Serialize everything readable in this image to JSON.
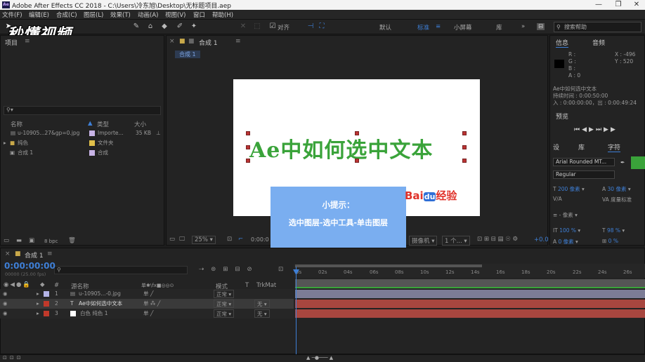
{
  "window": {
    "app_icon": "Ae",
    "title": "Adobe After Effects CC 2018 - C:\\Users\\冷东旭\\Desktop\\无标题项目.aep"
  },
  "menu": [
    "文件(F)",
    "编辑(E)",
    "合成(C)",
    "图层(L)",
    "效果(T)",
    "动画(A)",
    "视图(V)",
    "窗口",
    "帮助(H)"
  ],
  "watermark": "秒懂视频",
  "toolbar": {
    "align_label": "对齐",
    "workspaces": [
      "默认",
      "标准",
      "小屏幕",
      "库"
    ],
    "search_placeholder": "搜索帮助"
  },
  "project": {
    "title": "项目",
    "search_placeholder": "",
    "columns": [
      "名称",
      "类型",
      "大小"
    ],
    "items": [
      {
        "name": "u-10905...27&gp=0.jpg",
        "type": "Importe...",
        "size": "35 KB",
        "color": "#c8b4e6"
      },
      {
        "name": "纯色",
        "type": "文件夹",
        "size": "",
        "color": "#e0c04a"
      },
      {
        "name": "合成 1",
        "type": "合成",
        "size": "",
        "color": "#c8b4e6"
      }
    ],
    "bpc": "8 bpc"
  },
  "viewer": {
    "tab": "合成 1",
    "breadcrumb": "合成 1",
    "headline": "Ae中如何选中文本",
    "tip_title": "小提示：",
    "tip_body": "选中图层-选中工具-单击图层",
    "baidu_a": "Bai",
    "baidu_b": "du",
    "baidu_c": "经验",
    "zoom": "25%",
    "timecode": "0:00:0",
    "camera": "摄像机",
    "views": "1 个...",
    "exposure": "+0.0"
  },
  "info": {
    "tabs": [
      "信息",
      "音频"
    ],
    "r": "R :",
    "g": "G :",
    "b": "B :",
    "a": "A : 0",
    "x": "X : -496",
    "y": "Y : 520",
    "line1": "Ae中如何选中文本",
    "line2": "持续时间 : 0:00:50:00",
    "line3": "入 : 0:00:00:00，出 : 0:00:49:24"
  },
  "preview": {
    "title": "预览"
  },
  "character": {
    "tabs": [
      "设",
      "库",
      "字符"
    ],
    "font": "Arial Rounded MT...",
    "style": "Regular",
    "size": "200 像素",
    "leading": "30 像素",
    "tracking": "度量标准",
    "stroke": "- 像素",
    "vscale": "100 %",
    "hscale": "98 %",
    "baseline": "0 像素",
    "tsume": "0 %",
    "fill_color": "#3aa33a"
  },
  "timeline": {
    "tab": "合成 1",
    "timecode": "0:00:00:00",
    "fps": "00000 (25.00 fps)",
    "columns": [
      "#",
      "源名称",
      "单✱\\fx■◎◎⊙",
      "模式",
      "T",
      "TrkMat"
    ],
    "ruler": [
      "0s",
      "02s",
      "04s",
      "06s",
      "08s",
      "10s",
      "12s",
      "14s",
      "16s",
      "18s",
      "20s",
      "22s",
      "24s",
      "26s"
    ],
    "layers": [
      {
        "num": "1",
        "name": "u-10905...-0.jpg",
        "mode": "正常",
        "trk": "",
        "label": "#b4b4e6"
      },
      {
        "num": "2",
        "name": "Ae中如何选中文本",
        "mode": "正常",
        "trk": "无",
        "label": "#c0392b"
      },
      {
        "num": "3",
        "name": "白色 纯色 1",
        "mode": "正常",
        "trk": "无",
        "label": "#c0392b"
      }
    ]
  }
}
